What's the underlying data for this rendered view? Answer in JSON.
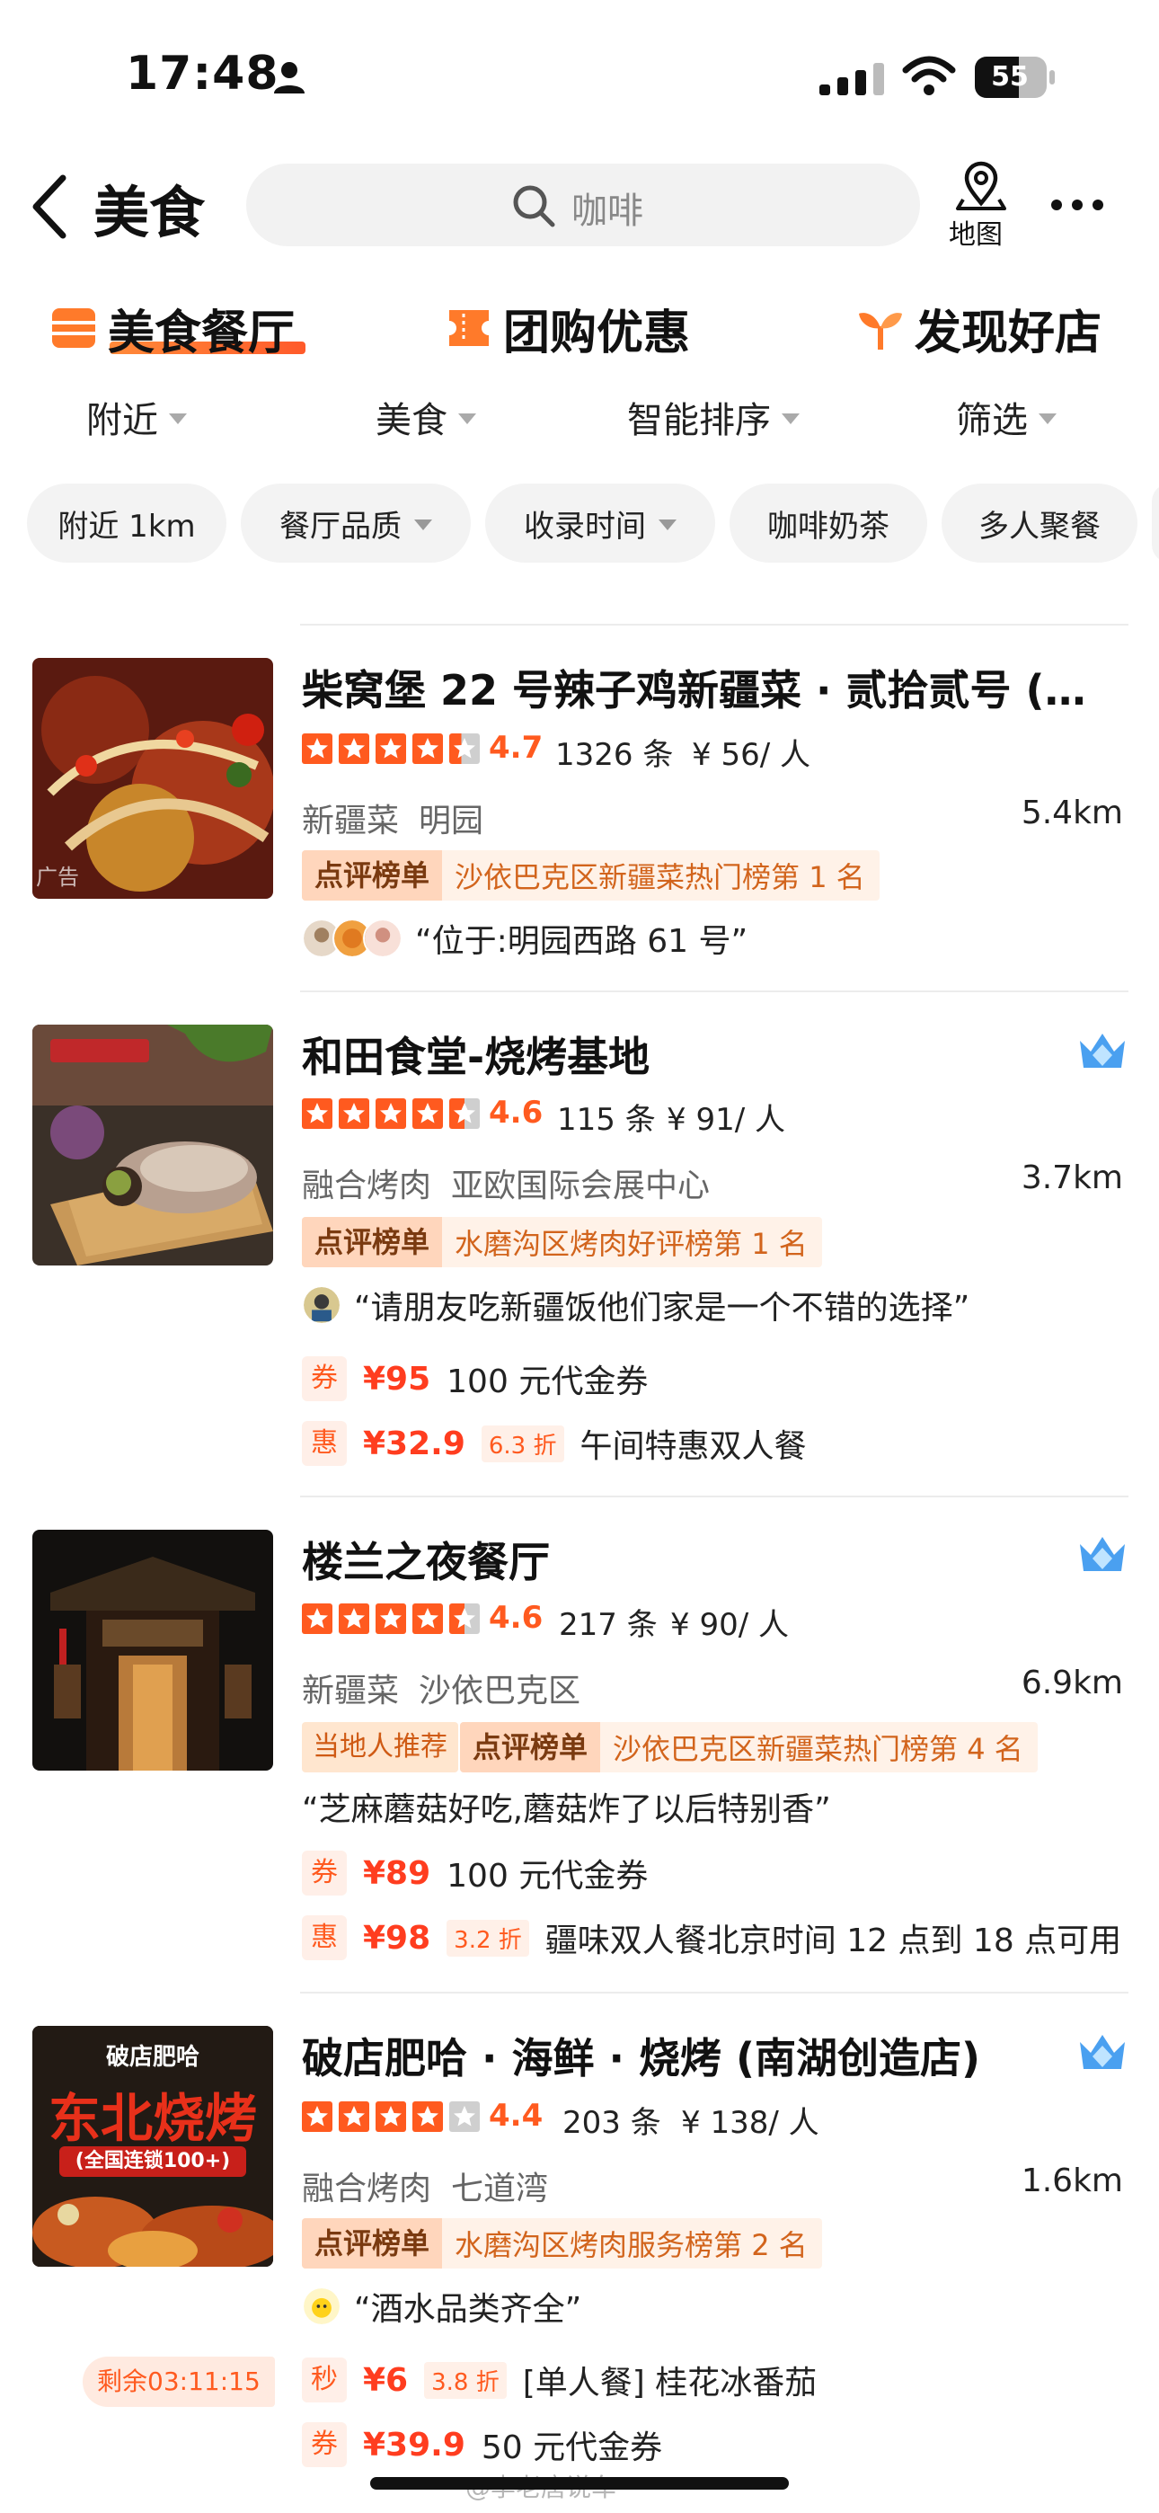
{
  "status_bar": {
    "time": "17:48",
    "battery": "55"
  },
  "nav": {
    "title": "美食",
    "search_placeholder": "咖啡",
    "map_label": "地图"
  },
  "category_tabs": [
    {
      "label": "美食餐厅",
      "active": true
    },
    {
      "label": "团购优惠",
      "active": false
    },
    {
      "label": "发现好店",
      "active": false
    }
  ],
  "filters": [
    "附近",
    "美食",
    "智能排序",
    "筛选"
  ],
  "chips": [
    {
      "label": "附近 1km"
    },
    {
      "label": "餐厅品质"
    },
    {
      "label": "收录时间"
    },
    {
      "label": "咖啡奶茶"
    },
    {
      "label": "多人聚餐"
    }
  ],
  "restaurants": [
    {
      "name": "柴窝堡 22 号辣子鸡新疆菜 · 贰拾贰号 (…",
      "score": "4.7",
      "rating": 4.7,
      "reviews": "1326 条",
      "price": "¥ 56/ 人",
      "cuisine": "新疆菜",
      "area": "明园",
      "distance": "5.4km",
      "ad_label": "广告",
      "rank_tag": "点评榜单",
      "rank_text": "沙依巴克区新疆菜热门榜第 1 名",
      "quote": "“位于:明园西路 61 号”"
    },
    {
      "name": "和田食堂-烧烤基地",
      "score": "4.6",
      "rating": 4.6,
      "reviews": "115 条",
      "price": "¥ 91/ 人",
      "cuisine": "融合烤肉",
      "area": "亚欧国际会展中心",
      "distance": "3.7km",
      "rank_tag": "点评榜单",
      "rank_text": "水磨沟区烤肉好评榜第 1 名",
      "quote": "“请朋友吃新疆饭他们家是一个不错的选择”",
      "deals": [
        {
          "icon": "券",
          "price": "¥95",
          "text": "100 元代金券"
        },
        {
          "icon": "惠",
          "price": "¥32.9",
          "discount": "6.3 折",
          "text": "午间特惠双人餐"
        }
      ]
    },
    {
      "name": "楼兰之夜餐厅",
      "score": "4.6",
      "rating": 4.6,
      "reviews": "217 条",
      "price": "¥ 90/ 人",
      "cuisine": "新疆菜",
      "area": "沙依巴克区",
      "distance": "6.9km",
      "local_tag": "当地人推荐",
      "rank_tag": "点评榜单",
      "rank_text": "沙依巴克区新疆菜热门榜第 4 名",
      "quote": "“芝麻蘑菇好吃,蘑菇炸了以后特别香”",
      "deals": [
        {
          "icon": "券",
          "price": "¥89",
          "text": "100 元代金券"
        },
        {
          "icon": "惠",
          "price": "¥98",
          "discount": "3.2 折",
          "text": "疆味双人餐北京时间 12 点到 18 点可用"
        }
      ]
    },
    {
      "name": "破店肥哈 · 海鲜 · 烧烤 (南湖创造店)",
      "score": "4.4",
      "rating": 4.4,
      "reviews": "203 条",
      "price": "¥ 138/ 人",
      "cuisine": "融合烤肉",
      "area": "七道湾",
      "distance": "1.6km",
      "thumb_text_top": "破店肥哈",
      "thumb_text_main": "东北烧烤",
      "thumb_text_sub": "(全国连锁100+)",
      "rank_tag": "点评榜单",
      "rank_text": "水磨沟区烤肉服务榜第 2 名",
      "quote": "“酒水品类齐全”",
      "countdown": "剩余03:11:15",
      "deals": [
        {
          "icon": "秒",
          "price": "¥6",
          "discount": "3.8 折",
          "text": "[单人餐] 桂花冰番茄"
        },
        {
          "icon": "券",
          "price": "¥39.9",
          "text": "50 元代金券"
        }
      ]
    }
  ],
  "watermark": "@李老唐说车",
  "colors": {
    "accent": "#ff5a1f",
    "rank_bg": "#fff2e8",
    "chip_bg": "#f3f3f3"
  }
}
